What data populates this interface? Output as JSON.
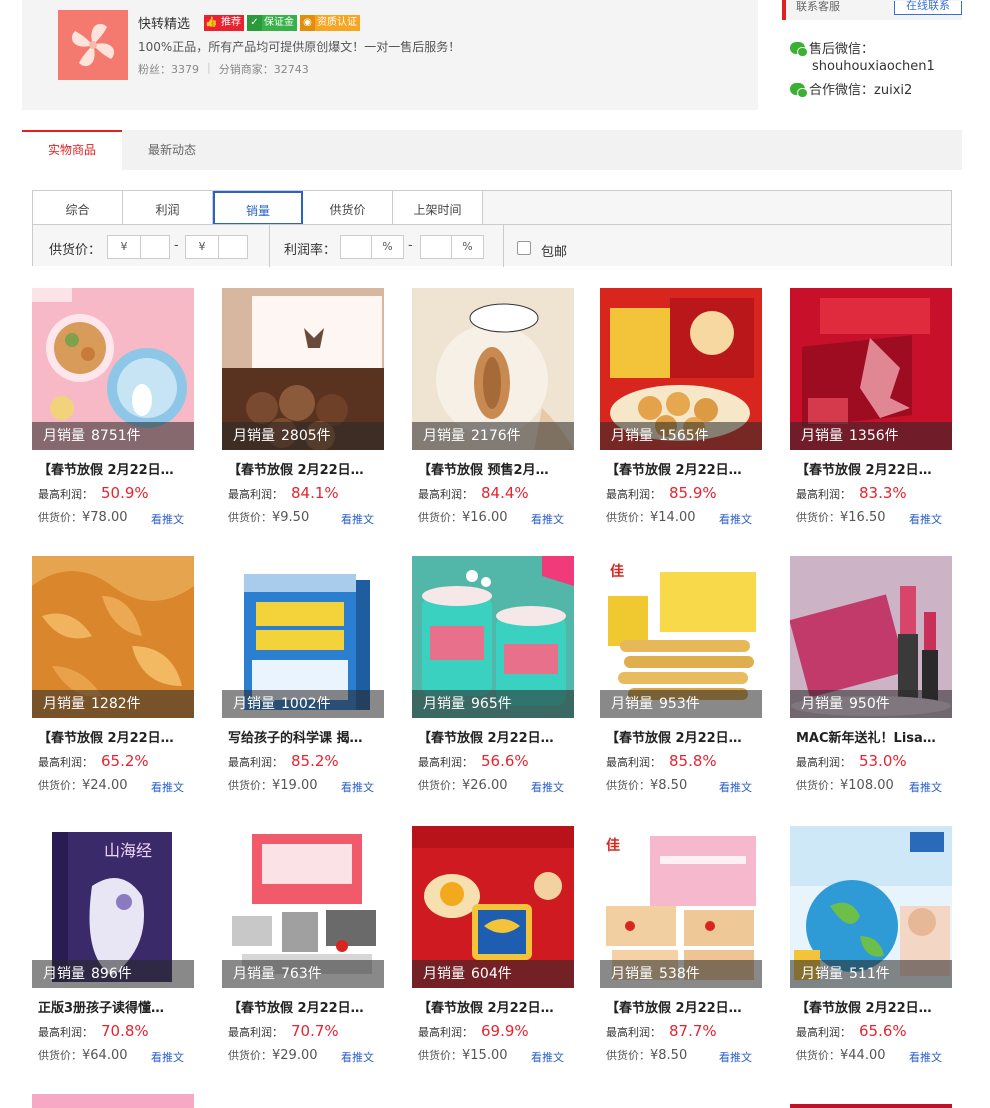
{
  "shop": {
    "name": "快转精选",
    "badges": {
      "recommend": "推荐",
      "guarantee": "保证金",
      "certified": "资质认证"
    },
    "description": "100%正品，所有产品均可提供原创爆文！一对一售后服务！",
    "fans_label": "粉丝：",
    "fans": "3379",
    "distributors_label": "分销商家：",
    "distributors": "32743"
  },
  "contact": {
    "label": "联系客服",
    "online_button": "在线联系",
    "aftersale_label": "售后微信：",
    "aftersale_id": "shouhouxiaochen1",
    "cooperate_label": "合作微信：",
    "cooperate_id": "zuixi2"
  },
  "tabs": [
    "实物商品",
    "最新动态"
  ],
  "sort": [
    "综合",
    "利润",
    "销量",
    "供货价",
    "上架时间"
  ],
  "filters": {
    "price_label": "供货价：",
    "currency": "¥",
    "dash": "-",
    "margin_label": "利润率：",
    "percent": "%",
    "free_shipping": "包邮"
  },
  "labels": {
    "monthly_sales": "月销量",
    "max_profit": "最高利润：",
    "supply_price": "供货价：",
    "view_article": "看推文"
  },
  "colors": {
    "accent_red": "#e8232f",
    "link_blue": "#2b5fc4",
    "active_blue": "#2b63c4"
  },
  "products": [
    {
      "sales": "8751件",
      "title": "【春节放假 2月22日…",
      "profit": "50.9%",
      "price": "¥78.00",
      "image": "cookie-tin"
    },
    {
      "sales": "2805件",
      "title": "【春节放假 2月22日…",
      "profit": "84.1%",
      "price": "¥9.50",
      "image": "chocolate-truffles"
    },
    {
      "sales": "2176件",
      "title": "【春节放假 预售2月…",
      "profit": "84.4%",
      "price": "¥16.00",
      "image": "nut-ball"
    },
    {
      "sales": "1565件",
      "title": "【春节放假 2月22日…",
      "profit": "85.9%",
      "price": "¥14.00",
      "image": "new-year-snacks"
    },
    {
      "sales": "1356件",
      "title": "【春节放假 2月22日…",
      "profit": "83.3%",
      "price": "¥16.50",
      "image": "red-gift-box"
    },
    {
      "sales": "1282件",
      "title": "【春节放假 2月22日…",
      "profit": "65.2%",
      "price": "¥24.00",
      "image": "chicken-feet"
    },
    {
      "sales": "1002件",
      "title": "写给孩子的科学课 揭…",
      "profit": "85.2%",
      "price": "¥19.00",
      "image": "science-book"
    },
    {
      "sales": "965件",
      "title": "【春节放假 2月22日…",
      "profit": "56.6%",
      "price": "¥26.00",
      "image": "hawthorn-cups"
    },
    {
      "sales": "953件",
      "title": "【春节放假 2月22日…",
      "profit": "85.8%",
      "price": "¥8.50",
      "image": "egg-rolls"
    },
    {
      "sales": "950件",
      "title": "MAC新年送礼！Lisa…",
      "profit": "53.0%",
      "price": "¥108.00",
      "image": "lipstick"
    },
    {
      "sales": "896件",
      "title": "正版3册孩子读得懂…",
      "profit": "70.8%",
      "price": "¥64.00",
      "image": "shanhaijing-book"
    },
    {
      "sales": "763件",
      "title": "【春节放假 2月22日…",
      "profit": "70.7%",
      "price": "¥29.00",
      "image": "building-blocks"
    },
    {
      "sales": "604件",
      "title": "【春节放假 2月22日…",
      "profit": "69.9%",
      "price": "¥15.00",
      "image": "egg-yolk-pastry"
    },
    {
      "sales": "538件",
      "title": "【春节放假 2月22日…",
      "profit": "87.7%",
      "price": "¥8.50",
      "image": "nougat-snacks"
    },
    {
      "sales": "511件",
      "title": "【春节放假 2月22日…",
      "profit": "65.6%",
      "price": "¥44.00",
      "image": "ar-globe"
    }
  ]
}
